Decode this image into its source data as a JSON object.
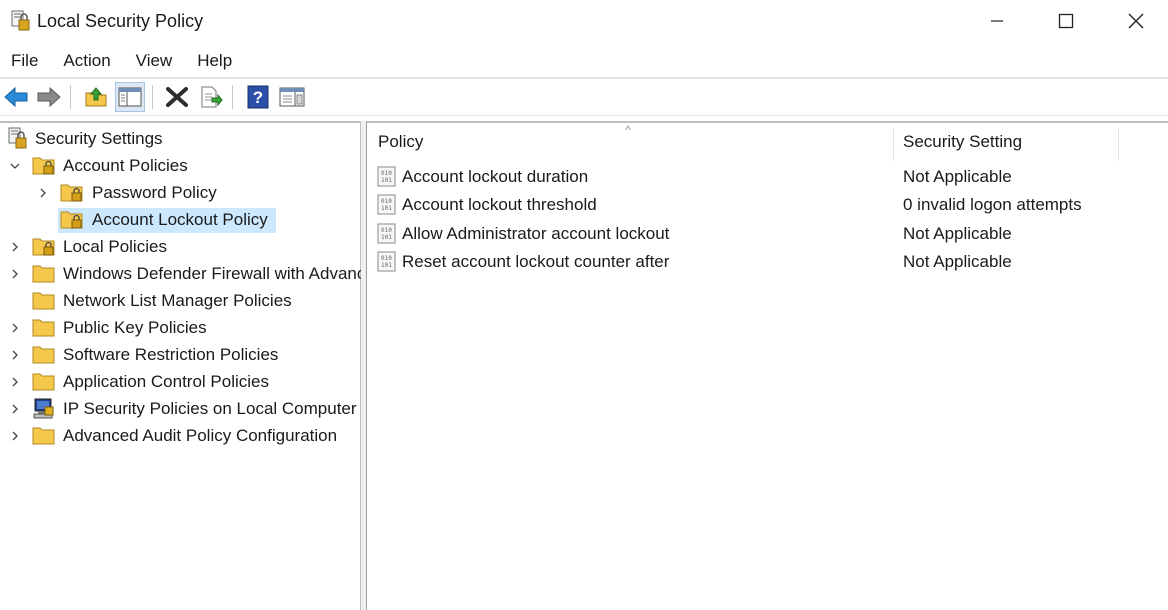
{
  "window": {
    "title": "Local Security Policy"
  },
  "menu": {
    "items": [
      "File",
      "Action",
      "View",
      "Help"
    ]
  },
  "toolbar": {
    "buttons": [
      "back-icon",
      "forward-icon",
      "up-folder-icon",
      "show-hide-tree-icon",
      "delete-icon",
      "export-list-icon",
      "help-icon",
      "properties-view-icon"
    ],
    "pressed": "show-hide-tree-icon"
  },
  "tree": {
    "root": "Security Settings",
    "items": [
      {
        "label": "Account Policies",
        "state": "expanded"
      },
      {
        "label": "Password Policy",
        "state": "collapsed"
      },
      {
        "label": "Account Lockout Policy",
        "state": "selected"
      },
      {
        "label": "Local Policies",
        "state": "collapsed"
      },
      {
        "label": "Windows Defender Firewall with Advanced Security",
        "state": "collapsed"
      },
      {
        "label": "Network List Manager Policies",
        "state": "leaf"
      },
      {
        "label": "Public Key Policies",
        "state": "collapsed"
      },
      {
        "label": "Software Restriction Policies",
        "state": "collapsed"
      },
      {
        "label": "Application Control Policies",
        "state": "collapsed"
      },
      {
        "label": "IP Security Policies on Local Computer",
        "state": "collapsed"
      },
      {
        "label": "Advanced Audit Policy Configuration",
        "state": "collapsed"
      }
    ]
  },
  "list": {
    "columns": [
      "Policy",
      "Security Setting"
    ],
    "sort_indicator": "^",
    "rows": [
      {
        "policy": "Account lockout duration",
        "setting": "Not Applicable"
      },
      {
        "policy": "Account lockout threshold",
        "setting": "0 invalid logon attempts"
      },
      {
        "policy": "Allow Administrator account lockout",
        "setting": "Not Applicable"
      },
      {
        "policy": "Reset account lockout counter after",
        "setting": "Not Applicable"
      }
    ]
  },
  "colors": {
    "selection": "#cce8ff",
    "folder": "#f5c84c",
    "lock": "#d4a017",
    "arrow_blue": "#2a8bd8"
  }
}
